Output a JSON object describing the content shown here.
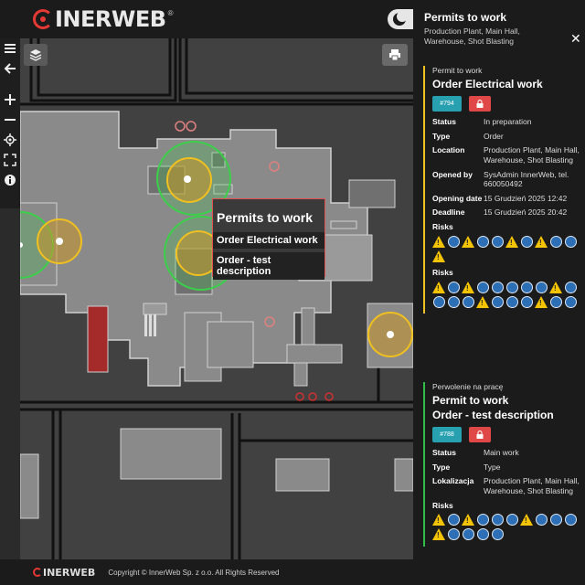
{
  "header": {
    "logo_text": "INERWEB",
    "logo_mark": "®"
  },
  "toolbar": {
    "items": [
      {
        "name": "menu-icon"
      },
      {
        "name": "back-arrow-icon"
      },
      {
        "name": "zoom-in-icon"
      },
      {
        "name": "zoom-out-icon"
      },
      {
        "name": "locate-icon"
      },
      {
        "name": "fullscreen-icon"
      },
      {
        "name": "info-icon"
      }
    ]
  },
  "popup": {
    "title": "Permits to work",
    "items": [
      "Order Electrical work",
      "Order - test description"
    ]
  },
  "footer": {
    "logo_text": "INERWEB",
    "copyright": "Copyright © InnerWeb Sp. z o.o. All Rights Reserved"
  },
  "panel": {
    "title": "Permits to work",
    "subtitle": "Production Plant, Main Hall, Warehouse, Shot Blasting",
    "close": "✕",
    "cards": [
      {
        "kicker": "Permit to work",
        "title": "Order Electrical work",
        "id": "#794",
        "fields": [
          {
            "k": "Status",
            "v": "In preparation"
          },
          {
            "k": "Type",
            "v": "Order"
          },
          {
            "k": "Location",
            "v": "Production Plant, Main Hall, Warehouse, Shot Blasting"
          },
          {
            "k": "Opened by",
            "v": "SysAdmin InnerWeb, tel. 660050492"
          },
          {
            "k": "Opening date",
            "v": "15 Grudzień 2025 12:42"
          },
          {
            "k": "Deadline",
            "v": "15 Grudzień 2025 20:42"
          }
        ],
        "risk_sections": [
          {
            "label": "Risks",
            "icons": [
              "warn",
              "blue",
              "warn",
              "blue",
              "blue",
              "warn",
              "blue",
              "warn",
              "blue",
              "blue",
              "warn"
            ]
          },
          {
            "label": "Risks",
            "icons": [
              "warn",
              "blue",
              "warn",
              "blue",
              "blue",
              "blue",
              "blue",
              "blue",
              "warn",
              "blue",
              "blue",
              "blue",
              "blue",
              "warn",
              "blue",
              "blue",
              "blue",
              "warn",
              "blue",
              "blue"
            ]
          }
        ]
      },
      {
        "kicker": "Perwolenie na pracę",
        "title": "Permit to work",
        "title2": "Order - test description",
        "id": "#788",
        "fields": [
          {
            "k": "Status",
            "v": "Main work"
          },
          {
            "k": "Type",
            "v": "Type"
          },
          {
            "k": "Lokalizacja",
            "v": "Production Plant, Main Hall, Warehouse, Shot Blasting"
          }
        ],
        "risk_sections": [
          {
            "label": "Risks",
            "icons": [
              "warn",
              "blue",
              "warn",
              "blue",
              "blue",
              "blue",
              "warn",
              "blue",
              "blue",
              "blue",
              "warn",
              "blue",
              "blue",
              "blue",
              "blue"
            ]
          }
        ]
      }
    ]
  },
  "colors": {
    "accent_red": "#e53935",
    "permit_yellow": "#f0c020",
    "permit_green": "#2fbf4a",
    "badge_teal": "#27a0b0"
  }
}
